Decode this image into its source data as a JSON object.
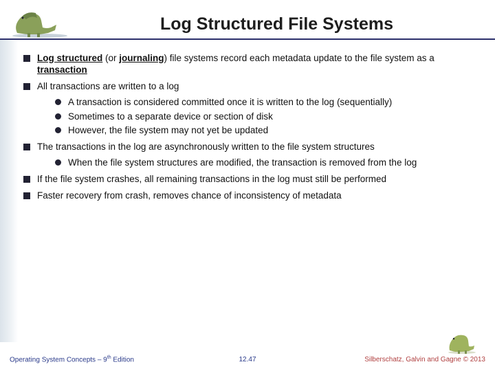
{
  "title": "Log Structured File Systems",
  "bullets": {
    "b1": {
      "pre": "Log structured",
      "mid": " (or ",
      "j": "journaling",
      "post": ") file systems record each metadata update to the file system as a ",
      "t": "transaction"
    },
    "b2": "All transactions are written to a log",
    "b2a": "A transaction is considered committed once it is written to the log (sequentially)",
    "b2b": "Sometimes to a separate device or section of disk",
    "b2c": "However, the file system may not yet be updated",
    "b3": "The transactions in the log are asynchronously written to the file system structures",
    "b3a": "When the file system structures are modified, the transaction is removed from the log",
    "b4": "If the file system crashes, all remaining transactions in the log must still be performed",
    "b5": "Faster recovery from crash, removes chance of inconsistency of metadata"
  },
  "footer": {
    "left_a": "Operating System Concepts – 9",
    "left_b": " Edition",
    "sup": "th",
    "center": "12.47",
    "right": "Silberschatz, Galvin and Gagne © 2013"
  }
}
